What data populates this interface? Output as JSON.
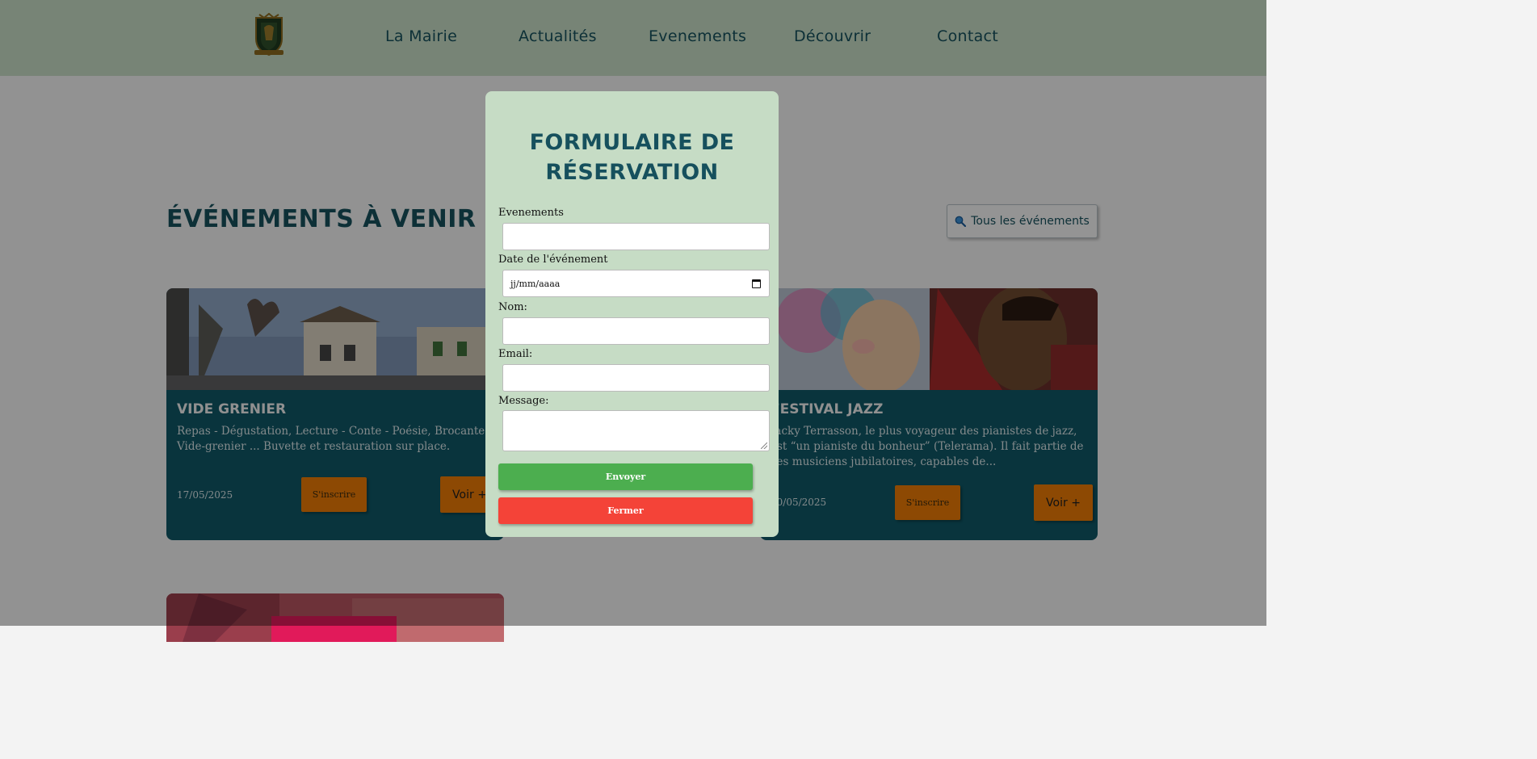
{
  "header": {
    "nav": [
      "La Mairie",
      "Actualités",
      "Evenements",
      "Découvrir",
      "Contact"
    ]
  },
  "page": {
    "section_title": "ÉVÉNEMENTS À VENIR",
    "all_events_label": "Tous les événements"
  },
  "events": [
    {
      "title": "VIDE GRENIER",
      "description": "Repas - Dégustation, Lecture - Conte - Poésie, Brocante - Vide-grenier ... Buvette et restauration sur place.",
      "date": "17/05/2025",
      "subscribe_label": "S'inscrire",
      "more_label": "Voir +"
    },
    {
      "title": "FESTIVAL JAZZ",
      "description": "Jacky Terrasson, le plus voyageur des pianistes de jazz, est “un pianiste du bonheur” (Telerama). Il fait partie de ces musiciens jubilatoires, capables de...",
      "date": "10/05/2025",
      "subscribe_label": "S'inscrire",
      "more_label": "Voir +"
    }
  ],
  "modal": {
    "title_line1": "FORMULAIRE DE",
    "title_line2": "RÉSERVATION",
    "event_label": "Evenements",
    "date_label": "Date de l'événement",
    "date_placeholder": "jj/mm/aaaa",
    "name_label": "Nom:",
    "email_label": "Email:",
    "message_label": "Message:",
    "send_label": "Envoyer",
    "close_label": "Fermer"
  },
  "icons": {
    "search": "search-icon",
    "calendar": "calendar-icon"
  }
}
